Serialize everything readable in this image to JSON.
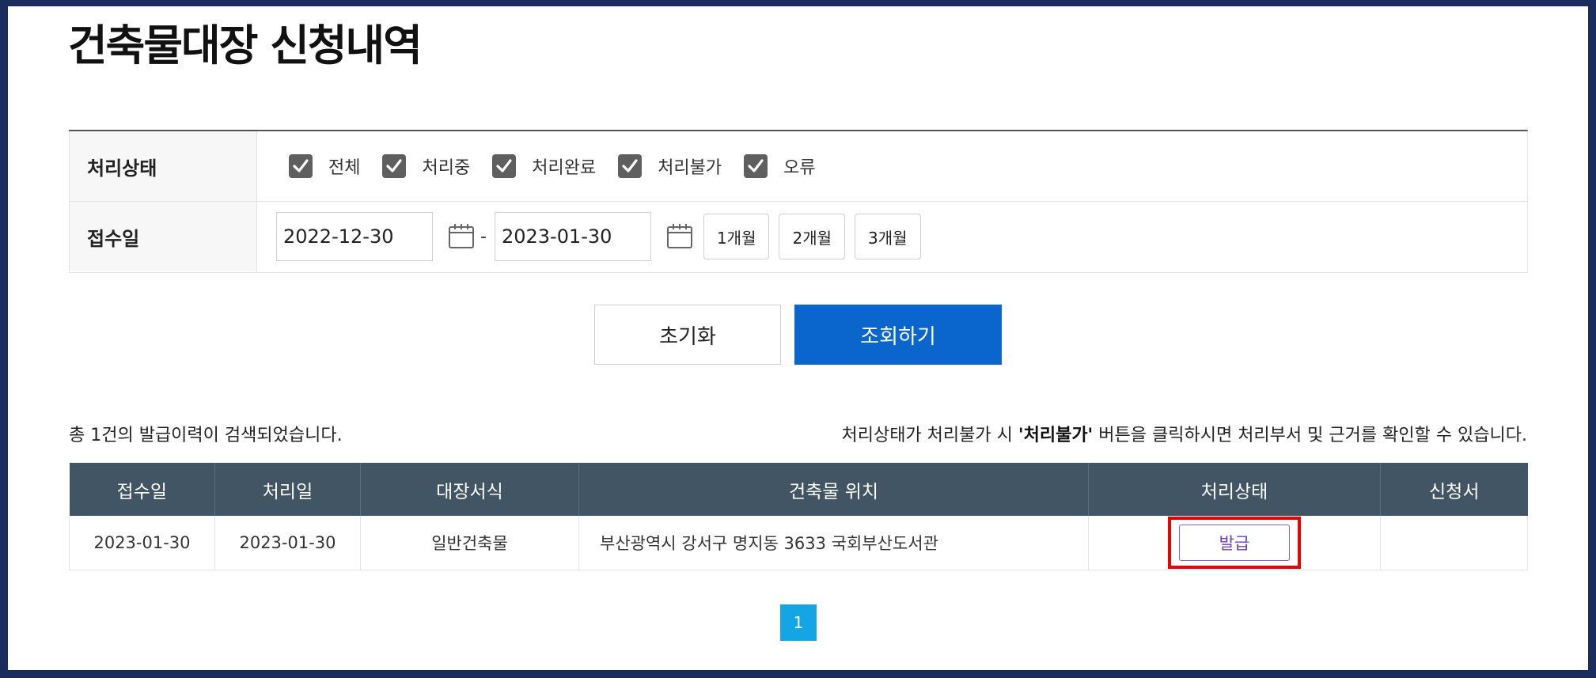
{
  "page": {
    "title": "건축물대장 신청내역"
  },
  "filter": {
    "status_label": "처리상태",
    "status_options": [
      {
        "label": "전체",
        "checked": true
      },
      {
        "label": "처리중",
        "checked": true
      },
      {
        "label": "처리완료",
        "checked": true
      },
      {
        "label": "처리불가",
        "checked": true
      },
      {
        "label": "오류",
        "checked": true
      }
    ],
    "date_label": "접수일",
    "date_from": "2022-12-30",
    "date_separator": "-",
    "date_to": "2023-01-30",
    "period_buttons": [
      "1개월",
      "2개월",
      "3개월"
    ]
  },
  "actions": {
    "reset_label": "초기화",
    "search_label": "조회하기"
  },
  "results": {
    "count_text": "총 1건의 발급이력이 검색되었습니다.",
    "notice_prefix": "처리상태가 처리불가 시 ",
    "notice_emphasis": "'처리불가'",
    "notice_suffix": " 버튼을 클릭하시면 처리부서 및 근거를 확인할 수 있습니다.",
    "columns": [
      "접수일",
      "처리일",
      "대장서식",
      "건축물 위치",
      "처리상태",
      "신청서"
    ],
    "rows": [
      {
        "received": "2023-01-30",
        "processed": "2023-01-30",
        "form": "일반건축물",
        "location": "부산광역시 강서구 명지동 3633 국회부산도서관",
        "status_button": "발급",
        "application": ""
      }
    ]
  },
  "pagination": {
    "current": "1"
  },
  "colors": {
    "primary": "#0a66cc",
    "table_header": "#415564",
    "highlight": "#ee0000",
    "pager": "#13a5e4",
    "frame": "#1b2d5e"
  }
}
